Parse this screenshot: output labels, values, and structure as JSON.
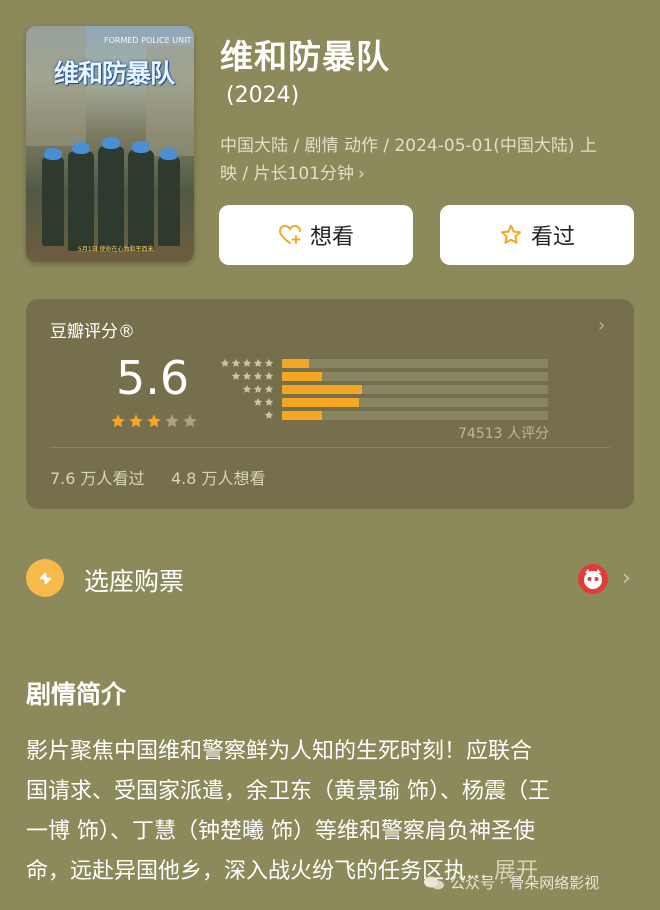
{
  "movie": {
    "title": "维和防暴队",
    "year": "(2024)",
    "meta_line1": "中国大陆 / 剧情 动作 / 2024-05-01(中国大陆) 上",
    "meta_line2": "映 / 片长101分钟",
    "poster": {
      "title_text": "维和防暴队",
      "top_text": "FORMED POLICE UNIT",
      "tagline": "5月1日 使命在心为和平而来"
    }
  },
  "actions": {
    "want_label": "想看",
    "watched_label": "看过"
  },
  "rating": {
    "label": "豆瓣评分®",
    "score": "5.6",
    "stars_filled": 3,
    "stars_total": 5,
    "distribution": [
      {
        "stars": 5,
        "fraction": 0.1
      },
      {
        "stars": 4,
        "fraction": 0.15
      },
      {
        "stars": 3,
        "fraction": 0.3
      },
      {
        "stars": 2,
        "fraction": 0.29
      },
      {
        "stars": 1,
        "fraction": 0.15
      }
    ],
    "count_text": "74513 人评分",
    "watched_text": "7.6 万人看过",
    "wanted_text": "4.8 万人想看"
  },
  "tickets": {
    "label": "选座购票"
  },
  "synopsis": {
    "heading": "剧情简介",
    "line1": "影片聚焦中国维和警察鲜为人知的生死时刻！应联合",
    "line2": "国请求、受国家派遣，余卫东（黄景瑜 饰）、杨震（王",
    "line3": "一博 饰）、丁慧（钟楚曦 饰）等维和警察肩负神圣使",
    "line4": "命，远赴异国他乡，深入战火纷飞的任务区执...",
    "more_label": "展开"
  },
  "watermark": {
    "text": "公众号 · 骨朵网络影视"
  },
  "colors": {
    "background": "#8c8a5b",
    "card": "#75704b",
    "accent": "#f5a623"
  }
}
